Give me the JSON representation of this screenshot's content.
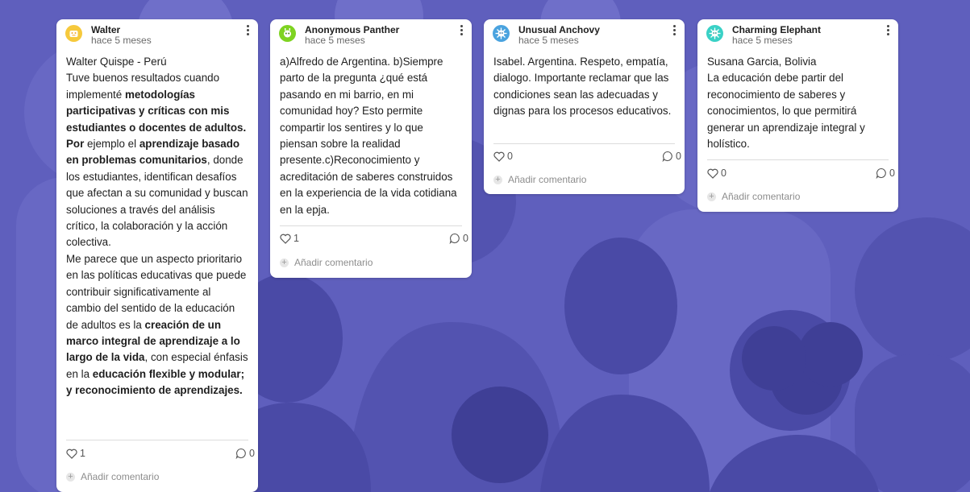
{
  "colors": {
    "background": "#5f5fbd",
    "card": "#ffffff",
    "text": "#1e1e1e",
    "muted": "#6a6a6a"
  },
  "posts": [
    {
      "author": "Walter",
      "time": "hace 5 meses",
      "avatar_color": "#f6c93c",
      "avatar_icon": "smiley-avatar-icon",
      "paragraphs": [
        "Walter Quispe - Perú",
        "Tuve buenos resultados cuando implementé metodologías participativas y críticas con mis estudiantes o docentes de adultos. Por ejemplo el aprendizaje basado en problemas comunitarios, donde los estudiantes, identifican desafíos que afectan a su comunidad y buscan soluciones a través del análisis crítico, la colaboración y la acción colectiva.",
        "Me parece que un aspecto prioritario en las políticas educativas que puede contribuir significativamente al cambio del sentido de la educación de adultos es la creación de un marco integral de aprendizaje a lo largo de la vida, con especial énfasis en la educación flexible y modular; y reconocimiento de aprendizajes."
      ],
      "likes": "1",
      "comments": "0",
      "add_comment": "Añadir comentario"
    },
    {
      "author": "Anonymous Panther",
      "time": "hace 5 meses",
      "avatar_color": "#7ed321",
      "avatar_icon": "alien-avatar-icon",
      "paragraphs": [
        "a)Alfredo de Argentina. b)Siempre parto de la pregunta ¿qué está pasando en mi barrio, en mi comunidad hoy? Esto permite compartir los sentires y lo que piensan sobre la realidad presente.c)Reconocimiento y acreditación de saberes construidos en la experiencia de la vida cotidiana en la epja."
      ],
      "likes": "1",
      "comments": "0",
      "add_comment": "Añadir comentario"
    },
    {
      "author": "Unusual Anchovy",
      "time": "hace 5 meses",
      "avatar_color": "#4aa3df",
      "avatar_icon": "virus-avatar-icon",
      "paragraphs": [
        "Isabel. Argentina. Respeto, empatía, dialogo. Importante reclamar que las condiciones sean las adecuadas y dignas para los procesos educativos."
      ],
      "likes": "0",
      "comments": "0",
      "add_comment": "Añadir comentario"
    },
    {
      "author": "Charming Elephant",
      "time": "hace 5 meses",
      "avatar_color": "#3ad1c6",
      "avatar_icon": "virus-avatar-icon",
      "paragraphs": [
        "Susana Garcia, Bolivia",
        "La educación debe partir del reconocimiento de saberes y conocimientos, lo que permitirá generar un aprendizaje integral y holístico."
      ],
      "likes": "0",
      "comments": "0",
      "add_comment": "Añadir comentario"
    }
  ]
}
